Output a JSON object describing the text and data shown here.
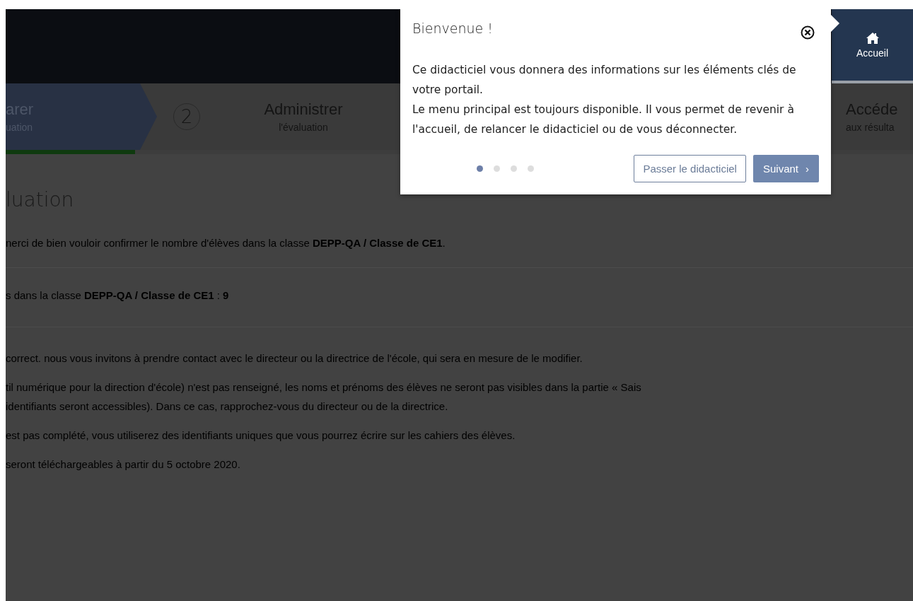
{
  "nav": {
    "home_tab": {
      "label": "Accueil"
    }
  },
  "steps": [
    {
      "title": "arer",
      "subtitle": "uation",
      "selected": true
    },
    {
      "number": "2",
      "title": "Administrer",
      "subtitle": "l'évaluation",
      "selected": false
    },
    {
      "title": "Accéde",
      "subtitle": "aux résulta",
      "selected": false
    }
  ],
  "progress": {
    "level": 0.143
  },
  "content": {
    "heading": "luation",
    "rows": [
      "nerci de bien vouloir confirmer le nombre d'élèves dans la classe **DEPP-QA / Classe de CE1**.",
      "s dans la classe **DEPP-QA / Classe de CE1** : **9**"
    ],
    "paragraphs": [
      [
        "correct. nous vous invitons à prendre contact avec le directeur ou la directrice de l'école, qui sera en mesure de le modifier."
      ],
      [
        "til numérique pour la direction d'école) n'est pas renseigné, les noms et prénoms des élèves ne seront pas visibles dans la partie « Sais",
        "identifiants seront accessibles). Dans ce cas, rapprochez-vous du directeur ou de la directrice."
      ],
      [
        "est pas complété, vous utiliserez des identifiants uniques que vous pourrez écrire sur les cahiers des élèves."
      ],
      [
        "seront téléchargeables à partir du 5 octobre 2020."
      ]
    ]
  },
  "tour": {
    "title": "Bienvenue !",
    "paragraphs": [
      "Ce didacticiel vous donnera des informations sur les éléments clés de votre portail.",
      "Le menu principal est toujours disponible. Il vous permet de revenir à l'accueil, de relancer le didacticiel ou de vous déconnecter."
    ],
    "dots": [
      {
        "selected": true
      },
      {
        "selected": false
      },
      {
        "selected": false
      },
      {
        "selected": false
      }
    ],
    "skip_button": "Passer le didacticiel",
    "next_button": "Suivant",
    "next_icon": "›"
  }
}
